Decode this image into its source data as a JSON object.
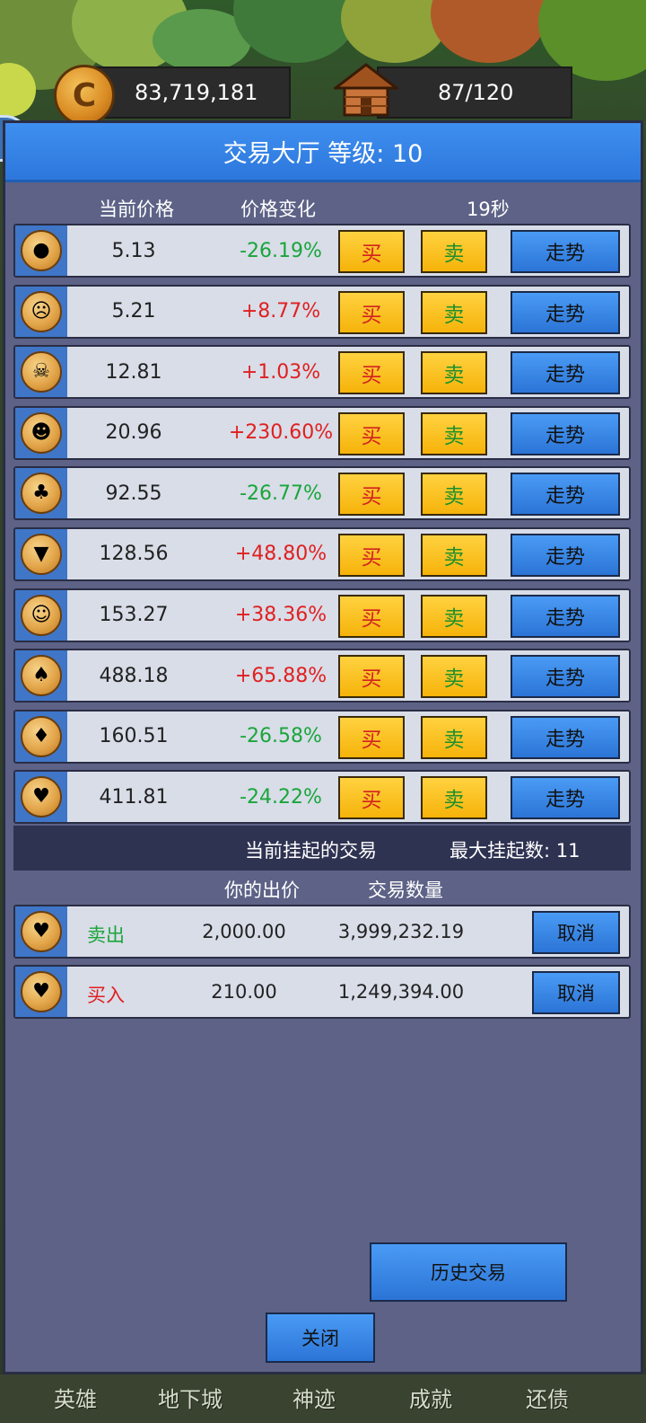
{
  "hud": {
    "coins": "83,719,181",
    "capacity": "87/120",
    "coin_symbol": "C"
  },
  "side_tab": {
    "label": "''"
  },
  "title": "交易大厅 等级: 10",
  "columns": {
    "current_price": "当前价格",
    "price_change": "价格变化",
    "timer": "19秒"
  },
  "market_rows": [
    {
      "icon": "slime-icon",
      "glyph": "●",
      "price": "5.13",
      "change": "-26.19%",
      "dir": "down",
      "buy": "买",
      "sell": "卖",
      "trend": "走势"
    },
    {
      "icon": "zombie-icon",
      "glyph": "☹",
      "price": "5.21",
      "change": "+8.77%",
      "dir": "up",
      "buy": "买",
      "sell": "卖",
      "trend": "走势"
    },
    {
      "icon": "skull-icon",
      "glyph": "☠",
      "price": "12.81",
      "change": "+1.03%",
      "dir": "up",
      "buy": "买",
      "sell": "卖",
      "trend": "走势"
    },
    {
      "icon": "goblin-icon",
      "glyph": "☻",
      "price": "20.96",
      "change": "+230.60%",
      "dir": "up",
      "buy": "买",
      "sell": "卖",
      "trend": "走势"
    },
    {
      "icon": "treant-icon",
      "glyph": "♣",
      "price": "92.55",
      "change": "-26.77%",
      "dir": "down",
      "buy": "买",
      "sell": "卖",
      "trend": "走势"
    },
    {
      "icon": "wolf-icon",
      "glyph": "▼",
      "price": "128.56",
      "change": "+48.80%",
      "dir": "up",
      "buy": "买",
      "sell": "卖",
      "trend": "走势"
    },
    {
      "icon": "orc-icon",
      "glyph": "☺",
      "price": "153.27",
      "change": "+38.36%",
      "dir": "up",
      "buy": "买",
      "sell": "卖",
      "trend": "走势"
    },
    {
      "icon": "mushroom-icon",
      "glyph": "♠",
      "price": "488.18",
      "change": "+65.88%",
      "dir": "up",
      "buy": "买",
      "sell": "卖",
      "trend": "走势"
    },
    {
      "icon": "imp-icon",
      "glyph": "♦",
      "price": "160.51",
      "change": "-26.58%",
      "dir": "down",
      "buy": "买",
      "sell": "卖",
      "trend": "走势"
    },
    {
      "icon": "dragon-icon",
      "glyph": "♥",
      "price": "411.81",
      "change": "-24.22%",
      "dir": "down",
      "buy": "买",
      "sell": "卖",
      "trend": "走势"
    }
  ],
  "pending": {
    "title": "当前挂起的交易",
    "max": "最大挂起数: 11",
    "bid_header": "你的出价",
    "qty_header": "交易数量"
  },
  "orders": [
    {
      "icon": "dragon-icon",
      "glyph": "♥",
      "type": "卖出",
      "kind": "sell",
      "bid": "2,000.00",
      "qty": "3,999,232.19",
      "cancel": "取消"
    },
    {
      "icon": "dragon-icon",
      "glyph": "♥",
      "type": "买入",
      "kind": "buy",
      "bid": "210.00",
      "qty": "1,249,394.00",
      "cancel": "取消"
    }
  ],
  "buttons": {
    "history": "历史交易",
    "close": "关闭"
  },
  "bottom_nav": [
    "英雄",
    "地下城",
    "神迹",
    "成就",
    "还债"
  ],
  "colors": {
    "up": "#e02020",
    "down": "#1aa53a",
    "accent_blue": "#2d77dc",
    "button_yellow": "#f6b30a"
  }
}
